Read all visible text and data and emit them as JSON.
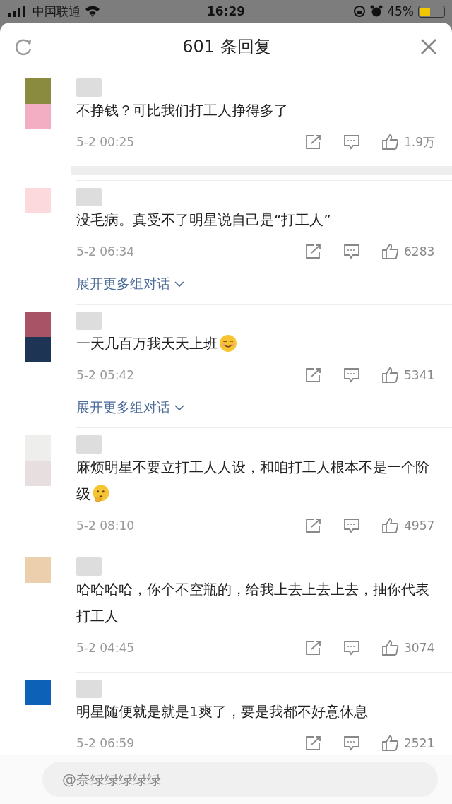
{
  "status_bar": {
    "carrier": "中国联通",
    "time": "16:29",
    "battery": "45%"
  },
  "header": {
    "title": "601 条回复"
  },
  "comments": [
    {
      "avatar": [
        {
          "color": "#8a8b3e"
        },
        {
          "color": "#f4aec4"
        }
      ],
      "text": "不挣钱？可比我们打工人挣得多了",
      "time": "5-2 00:25",
      "likes": "1.9万",
      "sub_bar": true
    },
    {
      "avatar": [
        {
          "color": "#fbd9dc"
        }
      ],
      "text": "没毛病。真受不了明星说自己是“打工人”",
      "time": "5-2 06:34",
      "likes": "6283",
      "expand_link": "展开更多组对话",
      "sub_bar": false
    },
    {
      "avatar": [
        {
          "color": "#a85466"
        },
        {
          "color": "#1d3454"
        }
      ],
      "text": "一天几百万我天天上班",
      "emoji": {
        "kind": "smile"
      },
      "time": "5-2 05:42",
      "likes": "5341",
      "expand_link": "展开更多组对话",
      "sub_bar": false
    },
    {
      "avatar": [
        {
          "color": "#eeeeec"
        },
        {
          "color": "#e6dedf"
        }
      ],
      "text": "麻烦明星不要立打工人人设，和咱打工人根本不是一个阶级",
      "emoji": {
        "kind": "thinking"
      },
      "time": "5-2 08:10",
      "likes": "4957",
      "sub_bar": false
    },
    {
      "avatar": [
        {
          "color": "#ecd0ae"
        }
      ],
      "text": "哈哈哈哈，你个不空瓶的，给我上去上去上去，抽你代表打工人",
      "time": "5-2 04:45",
      "likes": "3074",
      "sub_bar": false
    },
    {
      "avatar": [
        {
          "color": "#0d62b8"
        }
      ],
      "text": "明星随便就是就是1爽了，要是我都不好意休息",
      "time": "5-2 06:59",
      "likes": "2521",
      "sub_bar": false
    }
  ],
  "reply_input": {
    "placeholder": "@奈绿绿绿绿绿"
  }
}
